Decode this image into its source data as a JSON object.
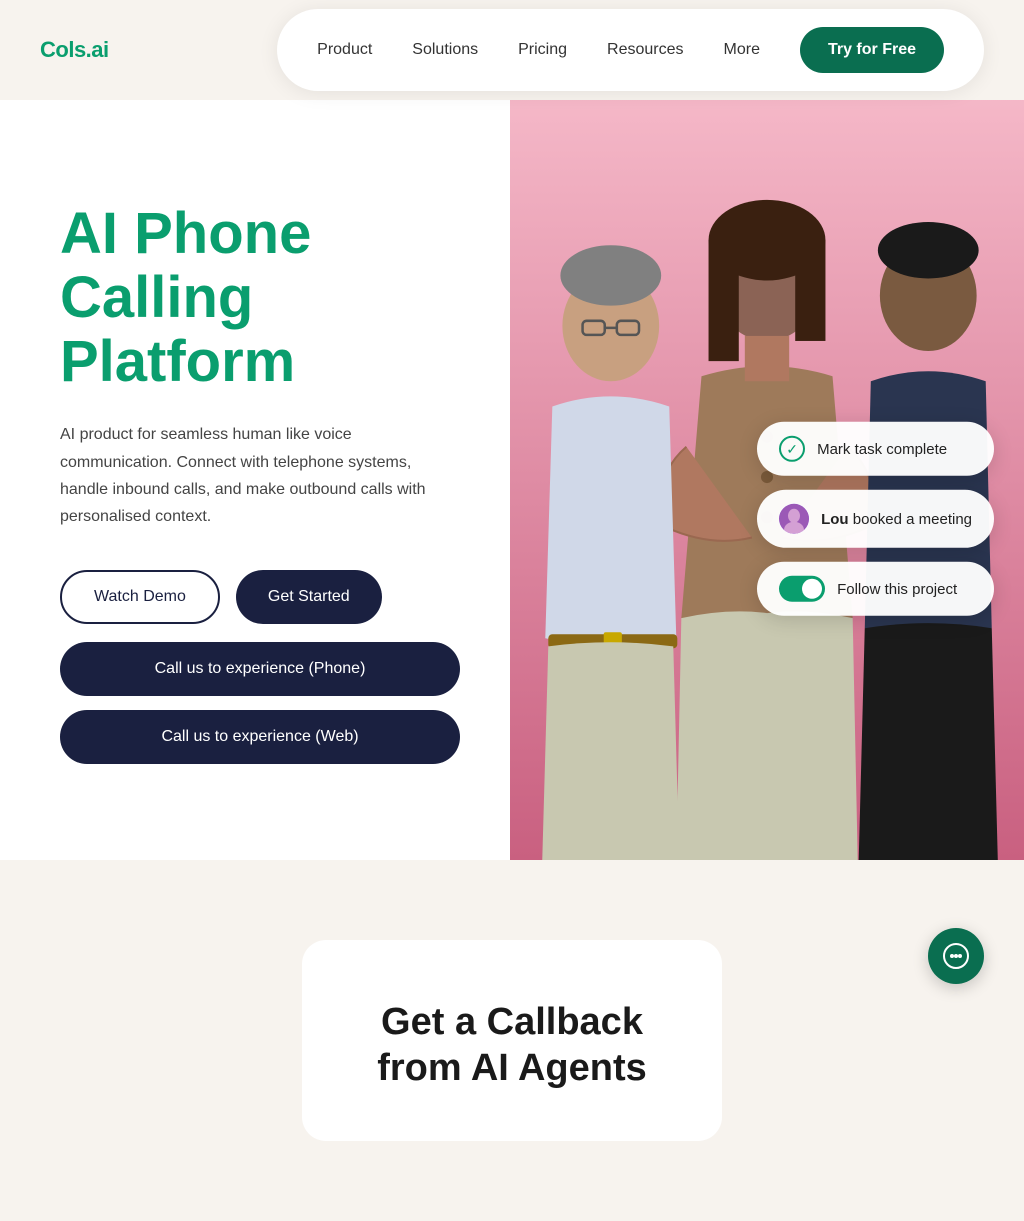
{
  "logo": {
    "text": "Cols.ai"
  },
  "nav": {
    "links": [
      {
        "label": "Product",
        "id": "product"
      },
      {
        "label": "Solutions",
        "id": "solutions"
      },
      {
        "label": "Pricing",
        "id": "pricing"
      },
      {
        "label": "Resources",
        "id": "resources"
      },
      {
        "label": "More",
        "id": "more"
      }
    ],
    "cta_label": "Try for Free"
  },
  "hero": {
    "title": "AI Phone Calling Platform",
    "subtitle": "AI product for seamless human like voice communication. Connect with telephone systems, handle inbound calls, and make outbound calls with personalised context.",
    "btn_watch_demo": "Watch Demo",
    "btn_get_started": "Get Started",
    "btn_call_phone": "Call us to experience (Phone)",
    "btn_call_web": "Call us to experience (Web)"
  },
  "floating_cards": {
    "mark_task": "Mark task complete",
    "lou_label": "Lou",
    "lou_action": " booked a meeting",
    "follow_project": "Follow this project"
  },
  "bottom": {
    "title": "Get a Callback from AI Agents"
  },
  "chat": {
    "icon_label": "chat-icon"
  }
}
